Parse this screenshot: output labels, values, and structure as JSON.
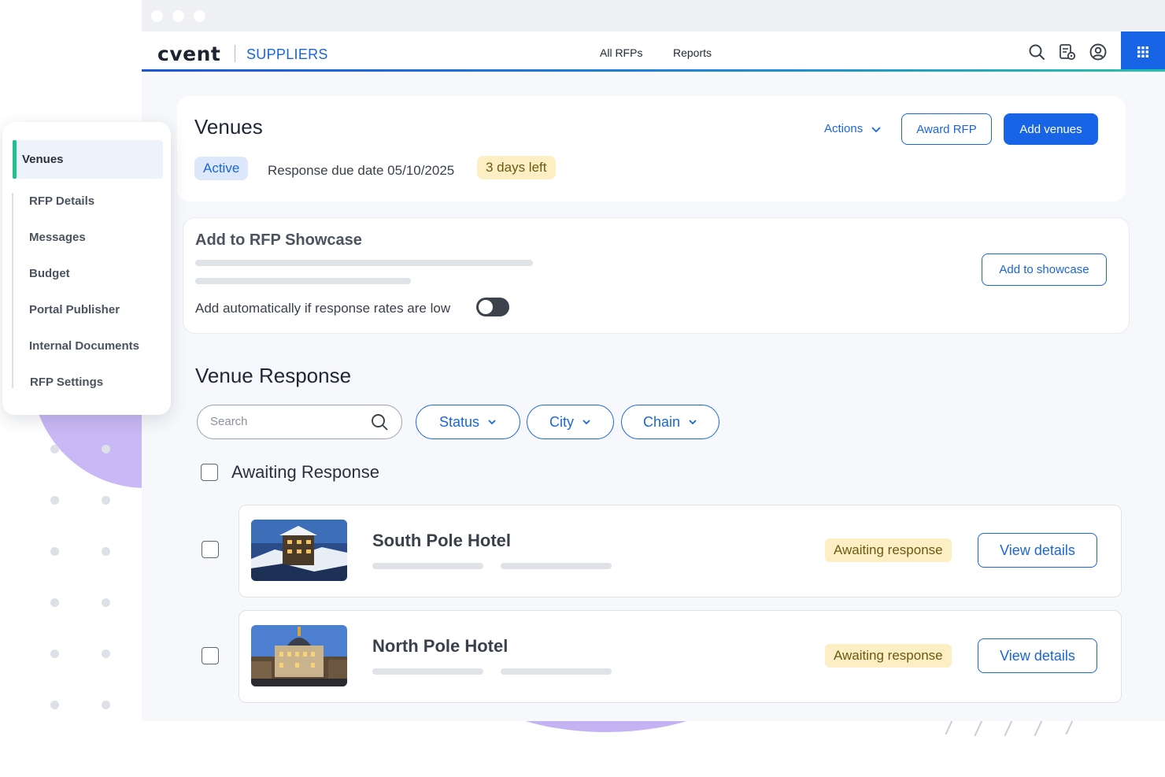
{
  "app": {
    "logo": "cvent",
    "product": "SUPPLIERS",
    "nav_links": [
      "All RFPs",
      "Reports"
    ]
  },
  "colors": {
    "brand_blue": "#1765e6",
    "active_accent": "#1fbf8f",
    "awaiting_bg": "#fcefc4"
  },
  "icons": {
    "header": [
      "search-icon",
      "calendar-settings-icon",
      "user-profile-icon",
      "apps-grid-icon"
    ]
  },
  "sidebar": {
    "items": [
      {
        "label": "Venues",
        "active": true
      },
      {
        "label": "RFP Details"
      },
      {
        "label": "Messages"
      },
      {
        "label": "Budget"
      },
      {
        "label": "Portal Publisher"
      },
      {
        "label": "Internal Documents"
      },
      {
        "label": "RFP Settings"
      }
    ]
  },
  "venues_header": {
    "title": "Venues",
    "status": "Active",
    "due_date": "Response due date 05/10/2025",
    "days_left": "3 days left",
    "actions_label": "Actions",
    "award_label": "Award RFP",
    "add_venues_label": "Add venues"
  },
  "showcase": {
    "title": "Add to RFP Showcase",
    "auto_label": "Add automatically if response rates are low",
    "toggle_on": false,
    "button_label": "Add to showcase"
  },
  "venue_response": {
    "title": "Venue Response",
    "search_placeholder": "Search",
    "filters": [
      "Status",
      "City",
      "Chain"
    ],
    "group_label": "Awaiting Response",
    "venues": [
      {
        "name": "South Pole Hotel",
        "status": "Awaiting response",
        "action": "View details"
      },
      {
        "name": "North Pole Hotel",
        "status": "Awaiting response",
        "action": "View details"
      }
    ]
  }
}
